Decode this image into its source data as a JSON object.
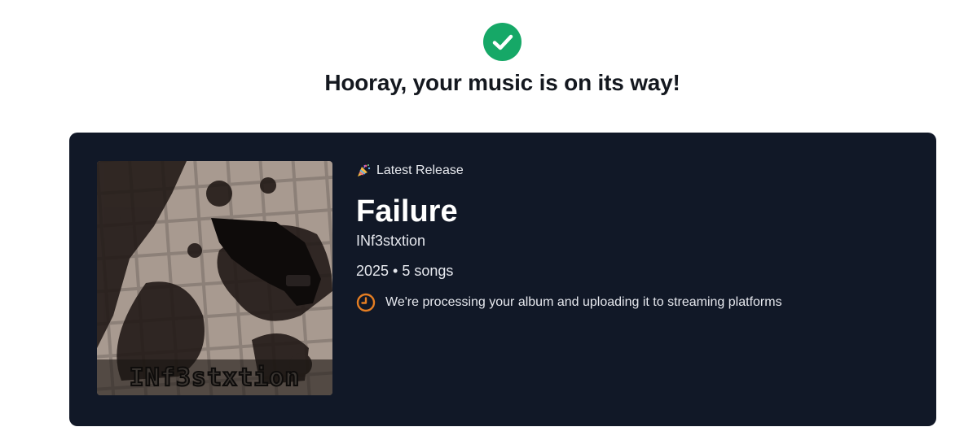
{
  "header": {
    "check_icon": "check-circle-icon",
    "title": "Hooray, your music is on its way!",
    "accent_color": "#16a867"
  },
  "release": {
    "badge_icon": "party-popper-icon",
    "badge_label": "Latest Release",
    "title": "Failure",
    "artist": "INf3stxtion",
    "meta": "2025 • 5 songs",
    "cover_text": "INf3stxtion",
    "status_icon": "clock-icon",
    "status_text": "We're processing your album and uploading it to streaming platforms",
    "status_color": "#e67e22",
    "card_color": "#111827"
  }
}
